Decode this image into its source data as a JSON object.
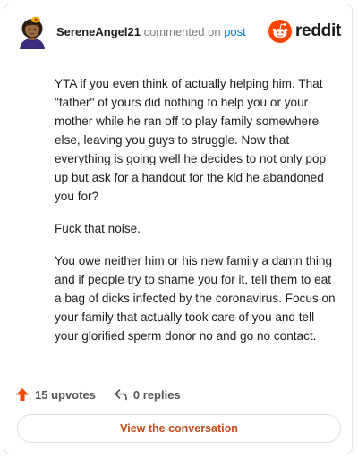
{
  "header": {
    "username": "SereneAngel21",
    "commented_on": "commented on",
    "post_link": "post",
    "brand": "reddit"
  },
  "comment": {
    "paragraphs": [
      "YTA if you even think of actually helping him. That \"father\" of yours did nothing to help you or your mother while he ran off to play family somewhere else, leaving you guys to struggle. Now that everything is going well he decides to not only pop up but ask for a handout for the kid he abandoned you for?",
      "Fuck that noise.",
      "You owe neither him or his new family a damn thing and if people try to shame you for it, tell them to eat a bag of dicks infected by the coronavirus. Focus on your family that actually took care of you and tell your glorified sperm donor no and go no contact."
    ]
  },
  "actions": {
    "upvotes": "15 upvotes",
    "replies": "0 replies"
  },
  "footer": {
    "view_label": "View the conversation"
  },
  "colors": {
    "brand_orange": "#ff4500",
    "link_blue": "#0079d3",
    "button_text": "#c34a1b"
  }
}
